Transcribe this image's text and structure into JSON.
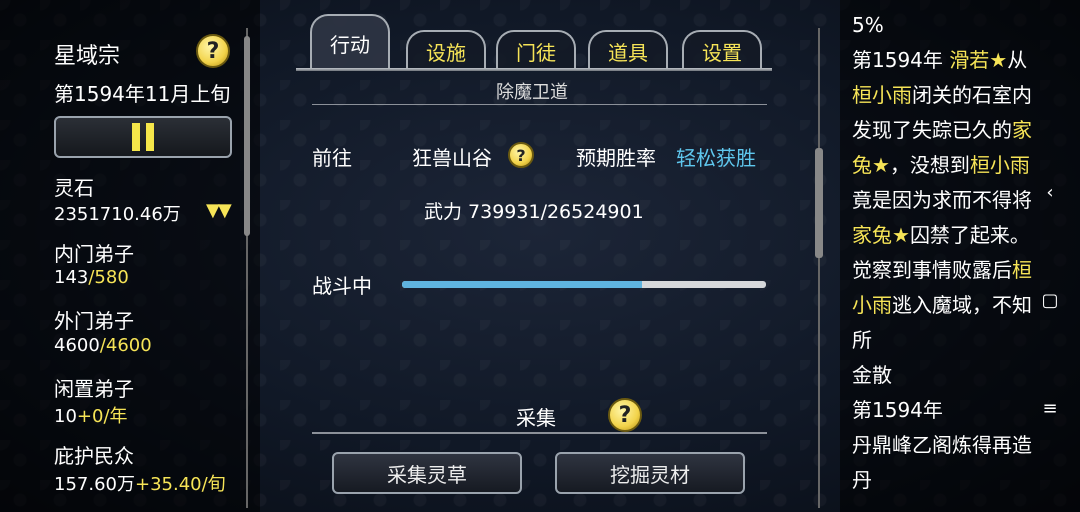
{
  "left": {
    "sect_name": "星域宗",
    "date": "第1594年11月上旬",
    "spirit_stone_label": "灵石",
    "spirit_stone_value": "2351710.46万",
    "inner_label": "内门弟子",
    "inner_current": "143",
    "inner_max": "/580",
    "outer_label": "外门弟子",
    "outer_current": "4600",
    "outer_max": "/4600",
    "idle_label": "闲置弟子",
    "idle_current": "10",
    "idle_rate": "+0/年",
    "people_label": "庇护民众",
    "people_current": "157.60万",
    "people_rate": "+35.40/旬"
  },
  "tabs": [
    {
      "label": "行动",
      "active": true
    },
    {
      "label": "设施",
      "active": false
    },
    {
      "label": "门徒",
      "active": false
    },
    {
      "label": "道具",
      "active": false
    },
    {
      "label": "设置",
      "active": false
    }
  ],
  "action": {
    "section_title": "除魔卫道",
    "go_label": "前往",
    "go_target": "狂兽山谷",
    "rate_label": "预期胜率",
    "rate_value": "轻松获胜",
    "power": "武力 739931/26524901",
    "fight_label": "战斗中",
    "progress": 0.66
  },
  "collect": {
    "title": "采集",
    "btn_herb": "采集灵草",
    "btn_mine": "挖掘灵材"
  },
  "log": {
    "top_percent": "5%",
    "y1": "第1594年",
    "n1": "滑若★",
    "t1": "从",
    "n2": "桓小雨",
    "t2": "闭关的石室内发现了失踪已久的",
    "n3": "家兔★",
    "t3": "，没想到",
    "n4": "桓小雨",
    "t4": "竟是因为求而不得将",
    "n5": "家兔★",
    "t5": "囚禁了起来。觉察到事情败露后",
    "n6": "桓小雨",
    "t6": "逃入魔域，不知所",
    "t7": "金散",
    "y2": "第1594年",
    "t8": "丹鼎峰乙阁炼得再造丹"
  },
  "icons": {
    "help": "?",
    "back": "‹",
    "home": "▢",
    "menu": "≡"
  },
  "colors": {
    "accent_yellow": "#f6e457",
    "accent_blue": "#5fc7ee"
  }
}
